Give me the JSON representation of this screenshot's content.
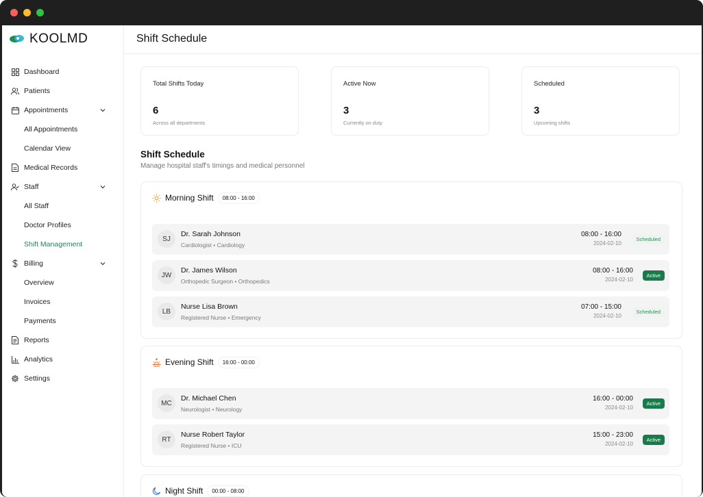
{
  "app": {
    "brand": "KOOLMD",
    "brand_color": "#1e8a55"
  },
  "sidebar": {
    "items": [
      {
        "label": "Dashboard",
        "icon": "grid-icon"
      },
      {
        "label": "Patients",
        "icon": "users-icon"
      },
      {
        "label": "Appointments",
        "icon": "calendar-icon",
        "expanded": true
      },
      {
        "label": "All Appointments"
      },
      {
        "label": "Calendar View"
      },
      {
        "label": "Medical Records",
        "icon": "file-icon"
      },
      {
        "label": "Staff",
        "icon": "user-check-icon",
        "expanded": true
      },
      {
        "label": "All Staff"
      },
      {
        "label": "Doctor Profiles"
      },
      {
        "label": "Shift Management",
        "active": true
      },
      {
        "label": "Billing",
        "icon": "dollar-icon",
        "expanded": true
      },
      {
        "label": "Overview"
      },
      {
        "label": "Invoices"
      },
      {
        "label": "Payments"
      },
      {
        "label": "Reports",
        "icon": "report-icon"
      },
      {
        "label": "Analytics",
        "icon": "bar-chart-icon"
      },
      {
        "label": "Settings",
        "icon": "gear-icon"
      }
    ]
  },
  "header": {
    "title": "Shift Schedule"
  },
  "stats": [
    {
      "label": "Total Shifts Today",
      "value": "6",
      "sub": "Across all departments"
    },
    {
      "label": "Active Now",
      "value": "3",
      "sub": "Currently on duty"
    },
    {
      "label": "Scheduled",
      "value": "3",
      "sub": "Upcoming shifts"
    }
  ],
  "section": {
    "title": "Shift Schedule",
    "subtitle": "Manage hospital staff's timings and medical personnel"
  },
  "shifts": [
    {
      "name": "Morning Shift",
      "range": "08:00 - 16:00",
      "icon": "sun-icon",
      "staff": [
        {
          "initials": "SJ",
          "name": "Dr. Sarah Johnson",
          "role": "Cardiologist • Cardiology",
          "time": "08:00 - 16:00",
          "date": "2024-02-10",
          "status": "Scheduled"
        },
        {
          "initials": "JW",
          "name": "Dr. James Wilson",
          "role": "Orthopedic Surgeon • Orthopedics",
          "time": "08:00 - 16:00",
          "date": "2024-02-10",
          "status": "Active"
        },
        {
          "initials": "LB",
          "name": "Nurse Lisa Brown",
          "role": "Registered Nurse • Emergency",
          "time": "07:00 - 15:00",
          "date": "2024-02-10",
          "status": "Scheduled"
        }
      ]
    },
    {
      "name": "Evening Shift",
      "range": "16:00 - 00:00",
      "icon": "sunset-icon",
      "staff": [
        {
          "initials": "MC",
          "name": "Dr. Michael Chen",
          "role": "Neurologist • Neurology",
          "time": "16:00 - 00:00",
          "date": "2024-02-10",
          "status": "Active"
        },
        {
          "initials": "RT",
          "name": "Nurse Robert Taylor",
          "role": "Registered Nurse • ICU",
          "time": "15:00 - 23:00",
          "date": "2024-02-10",
          "status": "Active"
        }
      ]
    },
    {
      "name": "Night Shift",
      "range": "00:00 - 08:00",
      "icon": "moon-icon",
      "staff": []
    }
  ],
  "colors": {
    "active_badge": "#1b7a4c",
    "scheduled_badge_bg": "#eef4ef",
    "scheduled_badge_text": "#2f8a56",
    "morning_icon": "#e39a2a",
    "evening_icon": "#e86a2a",
    "night_icon": "#3b6fd6"
  }
}
